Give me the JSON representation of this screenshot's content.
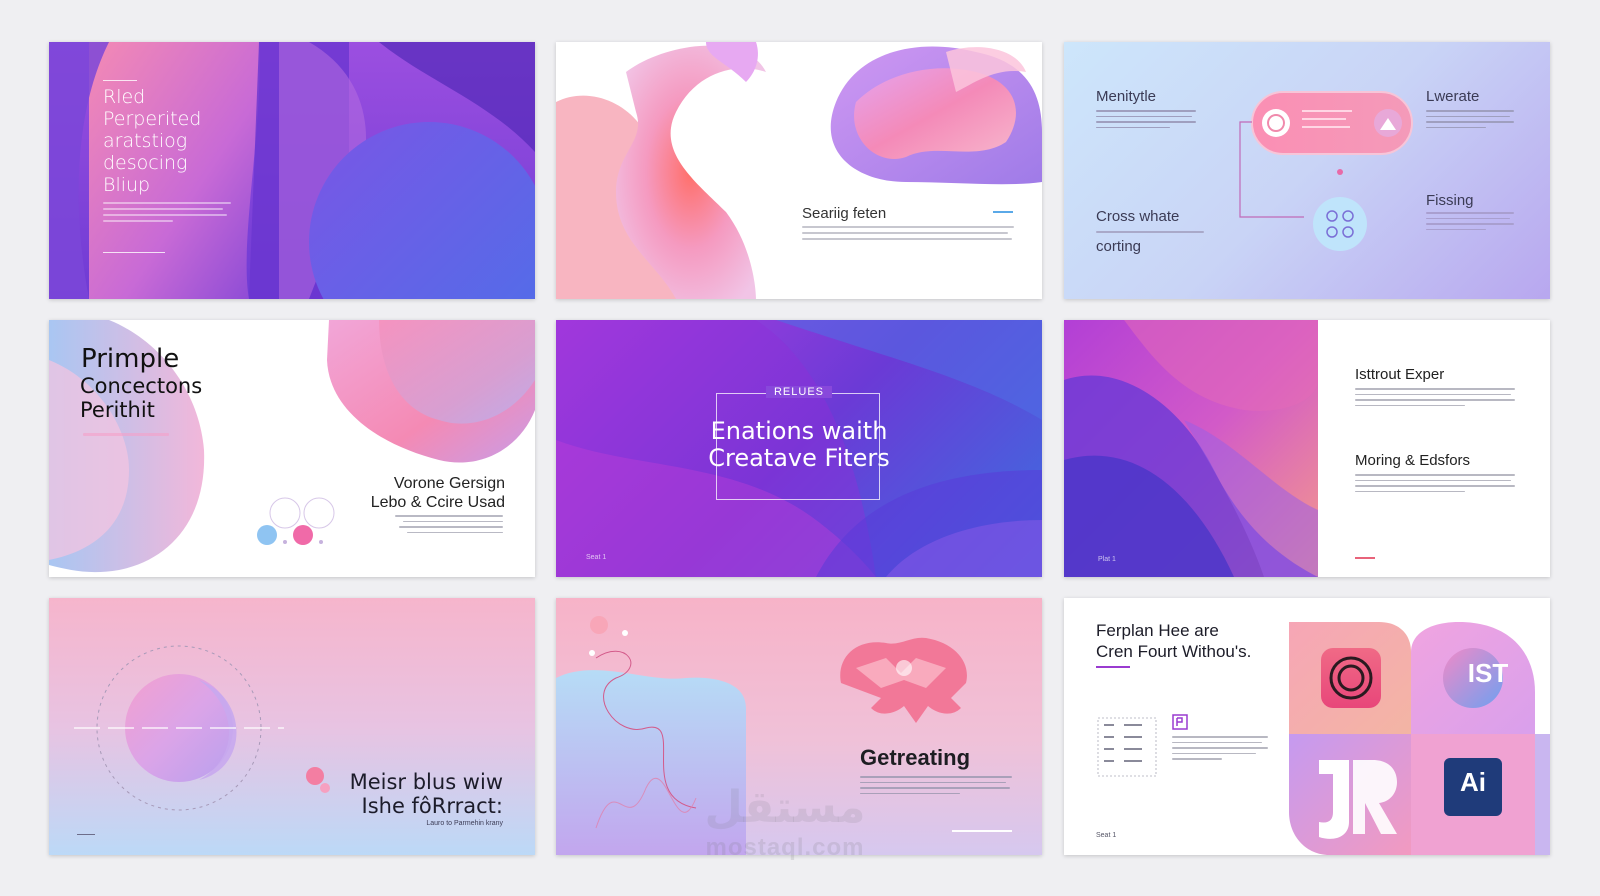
{
  "slides": {
    "s1": {
      "title_lines": [
        "Rled",
        "Perperited",
        "aratstiog",
        "desocing",
        "Bliup"
      ]
    },
    "s2": {
      "heading": "Seariig feten"
    },
    "s3": {
      "label_tl": "Menitytle",
      "label_tr": "Lwerate",
      "label_bl": "Cross whate",
      "label_bl2": "corting",
      "label_br": "Fissing"
    },
    "s4": {
      "title_1": "Primple",
      "title_2": "Concectons",
      "title_3": "Perithit",
      "right_1": "Vorone Gersign",
      "right_2": "Lebo & Ccire Usad"
    },
    "s5": {
      "tag": "RELUES",
      "title_1": "Enations waith",
      "title_2": "Creatave Fiters",
      "footer": "Seat 1"
    },
    "s6": {
      "heading_1": "Isttrout Exper",
      "heading_2": "Moring & Edsfors",
      "footer": "Plat 1"
    },
    "s7": {
      "title_1": "Meisr blus wiw",
      "title_2": "Ishe fôRrract:",
      "sub": "Lauro to Parmehin krany"
    },
    "s8": {
      "heading": "Getreating"
    },
    "s9": {
      "title_1": "Ferplan Hee are",
      "title_2": "Cren Fourt Withou's.",
      "footer": "Seat 1",
      "badge_ist": "IST",
      "badge_ai": "Ai"
    }
  },
  "watermark": {
    "arabic": "مستقل",
    "latin": "mostaql.com"
  },
  "colors": {
    "pink": "#f07aa8",
    "purple": "#7a3bd6",
    "blue": "#5a8ae8",
    "lavender": "#c9b6f0"
  }
}
